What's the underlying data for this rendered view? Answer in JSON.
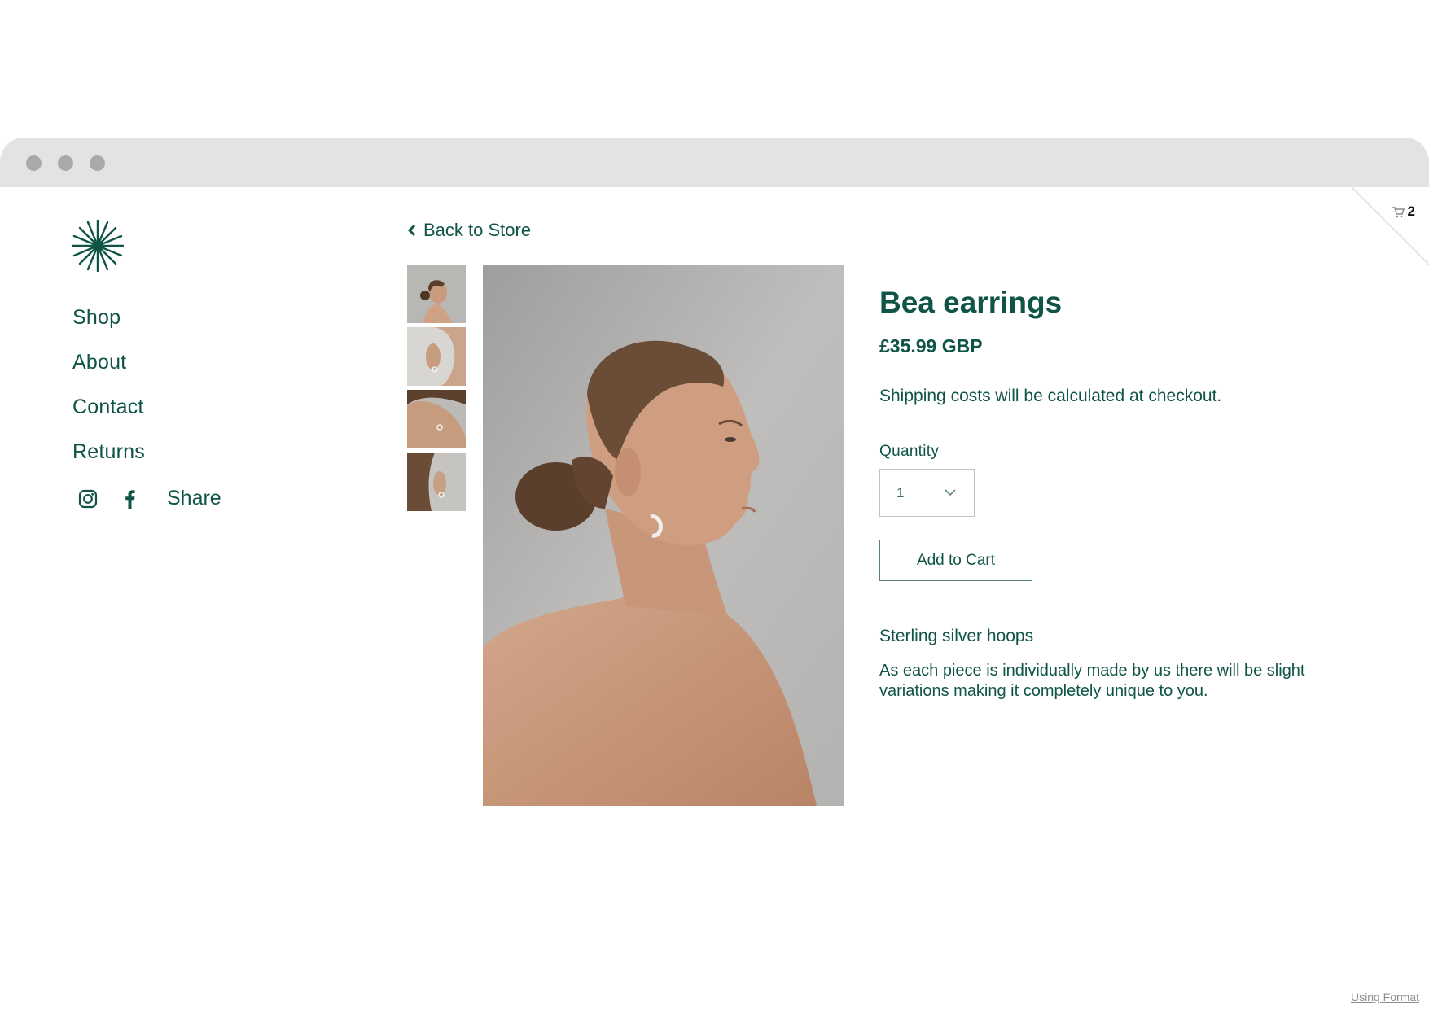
{
  "nav": {
    "items": [
      {
        "label": "Shop"
      },
      {
        "label": "About"
      },
      {
        "label": "Contact"
      },
      {
        "label": "Returns"
      }
    ],
    "share_label": "Share"
  },
  "cart": {
    "count": "2"
  },
  "back_link": {
    "label": "Back to Store"
  },
  "product": {
    "title": "Bea earrings",
    "price": "£35.99 GBP",
    "shipping_note": "Shipping costs will be calculated at checkout.",
    "quantity_label": "Quantity",
    "quantity_value": "1",
    "add_to_cart_label": "Add to Cart",
    "description_title": "Sterling silver hoops",
    "description_body": "As each piece is individually made by us there will be slight variations making it completely unique to you."
  },
  "footer": {
    "credit": "Using Format"
  },
  "colors": {
    "brand": "#0f5447",
    "chrome": "#e3e3e3",
    "chrome_dot": "#a9a9a9",
    "background": "#ffffff"
  },
  "icons": [
    "starburst-logo-icon",
    "cart-icon",
    "instagram-icon",
    "facebook-icon",
    "chevron-left-icon",
    "chevron-down-icon"
  ]
}
